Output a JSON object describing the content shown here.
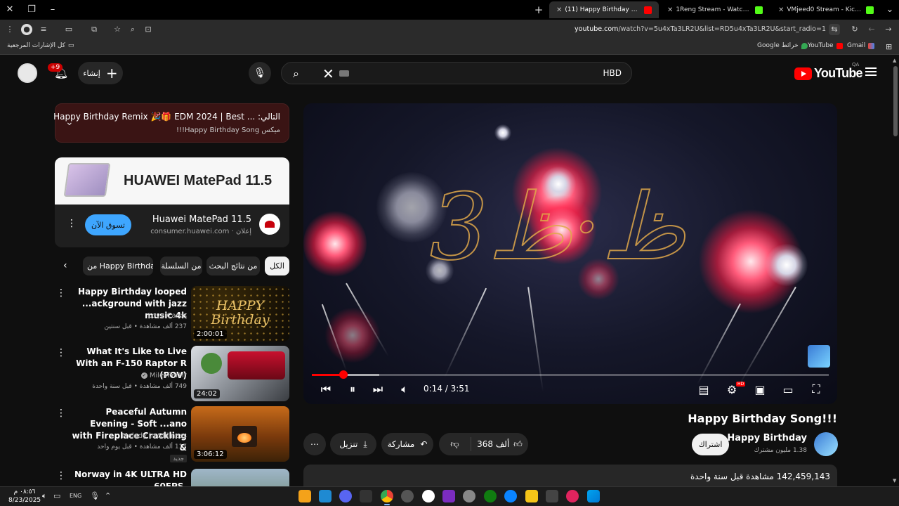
{
  "browser": {
    "tabs": [
      {
        "title": "(11) Happy Birthday Song!!!",
        "active": true
      },
      {
        "title": "1Reng Stream - Watch Live on Kick",
        "active": false
      },
      {
        "title": "VMjeed0 Stream - Kick Dashboard",
        "active": false
      }
    ],
    "url_host": "youtube.com",
    "url_path": "/watch?v=5u4xTa3LR2U&list=RD5u4xTa3LR2U&start_radio=1",
    "bookmarks": {
      "all": "كل الإشارات المرجعية",
      "google_maps": "Google خرائط",
      "youtube": "YouTube",
      "gmail": "Gmail"
    }
  },
  "header": {
    "notif_badge": "+9",
    "create_label": "إنشاء",
    "search_query": "HBD",
    "logo_text": "YouTube",
    "country": "QA"
  },
  "up_next": {
    "title": "التالي: ... Happy Birthday Remix 🎉🎁 EDM 2024 | Best",
    "subtitle": "ميكس Happy Birthday Song!!!"
  },
  "ad": {
    "banner_text": "HUAWEI MatePad 11.5",
    "title": "Huawei MatePad 11.5",
    "sponsor": "إعلان · consumer.huawei.com",
    "cta": "تسوق الآن"
  },
  "chips": [
    "الكل",
    "من نتائج البحث",
    "من السلسلة",
    "من Happy Birthday"
  ],
  "related": [
    {
      "title": "Happy Birthday looped ...ackground with jazz music 4k",
      "channel": "Love Cards",
      "meta": "237 ألف مشاهدة • قبل سنتين",
      "duration": "2:00:01",
      "thumb_text": "HAPPY Birthday",
      "is_new": ""
    },
    {
      "title": "What It's Like to Live With an F-150 Raptor R (POV)",
      "channel": "MilesPerHr",
      "meta": "749 ألف مشاهدة • قبل سنة واحدة",
      "duration": "24:02",
      "thumb_text": "",
      "is_new": ""
    },
    {
      "title": "Peaceful Autumn Evening - Soft ...ano with Fireplace Crackling &",
      "channel": "Melody in Stillness",
      "meta": "117 ألف مشاهدة • قبل يوم واحد",
      "duration": "3:06:12",
      "thumb_text": "",
      "is_new": "جديد"
    },
    {
      "title": "Norway in 4K ULTRA HD 60FPS,",
      "channel": "",
      "meta": "",
      "duration": "",
      "thumb_text": "",
      "is_new": ""
    }
  ],
  "player": {
    "time": "0:14 / 3:51",
    "progress_fraction": 0.061,
    "buffered_fraction": 0.13,
    "hd_badge": "HD"
  },
  "video": {
    "title": "Happy Birthday Song!!!",
    "channel": "Happy Birthday",
    "subscribers": "1.38 مليون مشترك",
    "subscribe_label": "اشتراك",
    "likes": "368 ألف",
    "share_label": "مشاركة",
    "download_label": "تنزيل",
    "views_line": "142,459,143 مشاهدة  قبل سنة واحدة"
  },
  "taskbar": {
    "time": "٠٨:٥٦ م",
    "date": "8/23/2025",
    "lang": "ENG"
  },
  "colors": {
    "accent_red": "#ff0000",
    "subscribe_bg": "#f1f1f1",
    "cta_blue": "#3ea6ff"
  }
}
